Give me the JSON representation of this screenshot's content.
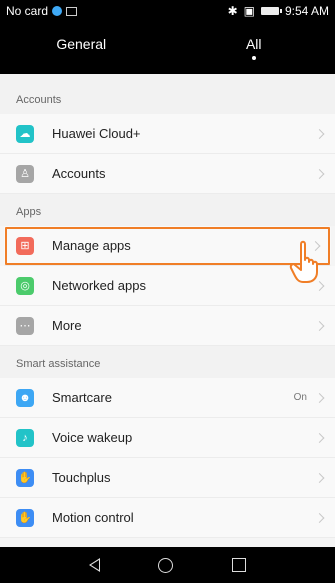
{
  "status_bar": {
    "carrier": "No card",
    "time": "9:54 AM"
  },
  "tabs": [
    {
      "label": "General",
      "active": false
    },
    {
      "label": "All",
      "active": true
    }
  ],
  "sections": {
    "accounts": {
      "title": "Accounts",
      "items": [
        {
          "label": "Huawei Cloud+",
          "icon": "cloud-icon",
          "color": "#22c3c8"
        },
        {
          "label": "Accounts",
          "icon": "user-icon",
          "color": "#a6a6a6"
        }
      ]
    },
    "apps": {
      "title": "Apps",
      "items": [
        {
          "label": "Manage apps",
          "icon": "apps-grid-icon",
          "color": "#f26b5b"
        },
        {
          "label": "Networked apps",
          "icon": "network-icon",
          "color": "#4ccb6c"
        },
        {
          "label": "More",
          "icon": "more-icon",
          "color": "#a6a6a6"
        }
      ]
    },
    "smart": {
      "title": "Smart assistance",
      "items": [
        {
          "label": "Smartcare",
          "value": "On",
          "icon": "smartcare-icon",
          "color": "#3da7f4"
        },
        {
          "label": "Voice wakeup",
          "icon": "voice-icon",
          "color": "#22c3c8"
        },
        {
          "label": "Touchplus",
          "icon": "touch-icon",
          "color": "#3d8df4"
        },
        {
          "label": "Motion control",
          "icon": "motion-icon",
          "color": "#3d8df4"
        }
      ]
    }
  },
  "colors": {
    "highlight": "#f07e27",
    "status_bar": "#000000"
  }
}
